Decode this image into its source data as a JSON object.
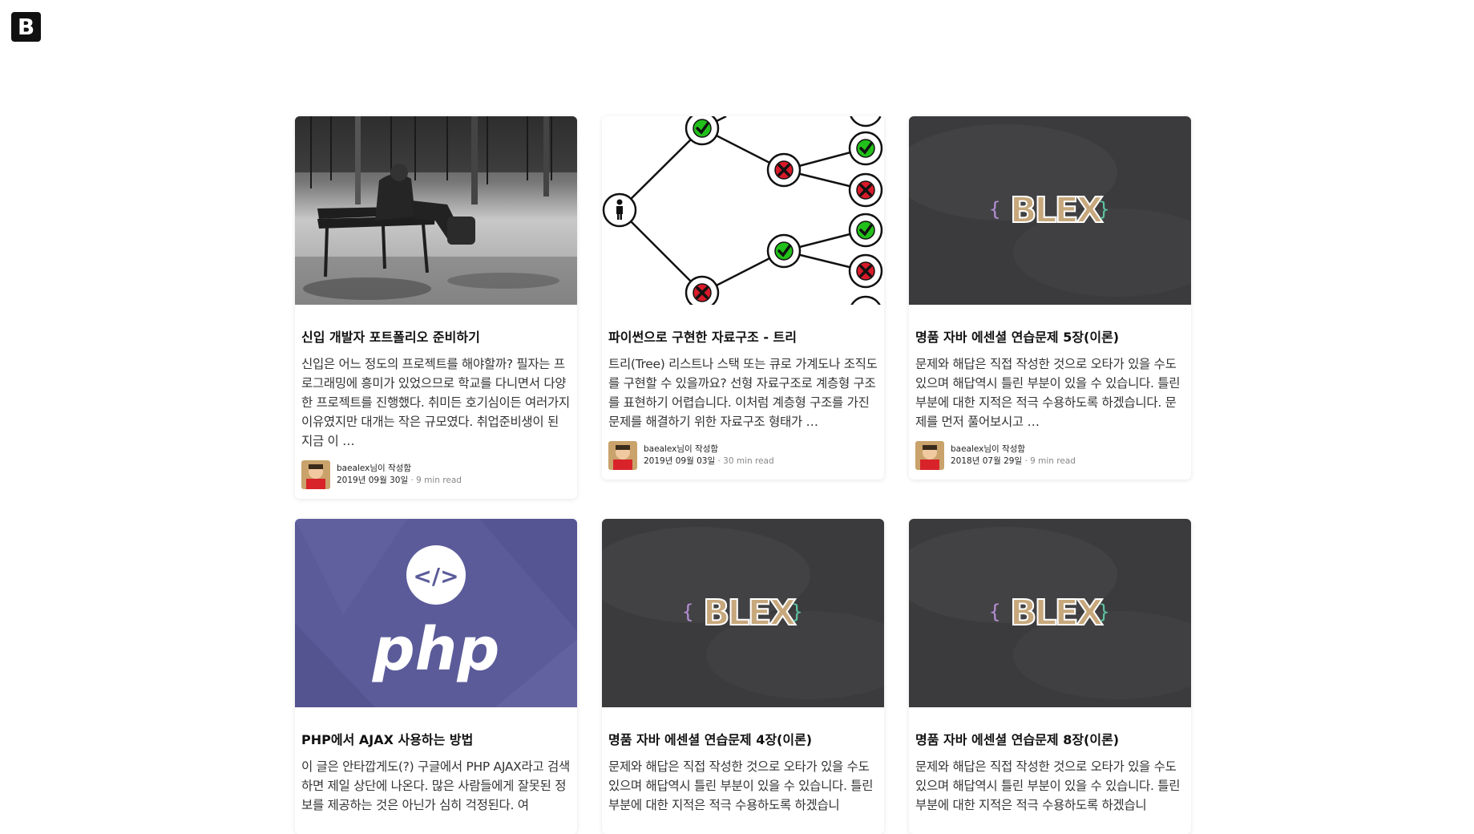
{
  "header": {
    "logo_letter": "B"
  },
  "posts": [
    {
      "title": "신입 개발자 포트폴리오 준비하기",
      "desc": "신입은 어느 정도의 프로젝트를 해야할까? 필자는 프로그래밍에 흥미가 있었으므로 학교를 다니면서 다양한 프로젝트를 진행했다. 취미든 호기심이든 여러가지 이유였지만 대개는 작은 규모였다. 취업준비생이 된 지금 이 …",
      "author": "baealex님이 작성함",
      "date": "2019년 09월 30일",
      "sep": "·",
      "read": "9 min read",
      "thumb": "bench-photo"
    },
    {
      "title": "파이썬으로 구현한 자료구조 - 트리",
      "desc": "트리(Tree) 리스트나 스택 또는 큐로 가계도나 조직도를 구현할 수 있을까요? 선형 자료구조로 계층형 구조를 표현하기 어렵습니다. 이처럼 계층형 구조를 가진 문제를 해결하기 위한 자료구조 형태가 …",
      "author": "baealex님이 작성함",
      "date": "2019년 09월 03일",
      "sep": "·",
      "read": "30 min read",
      "thumb": "tree-diagram"
    },
    {
      "title": "명품 자바 에센셜 연습문제 5장(이론)",
      "desc": "문제와 해답은 직접 작성한 것으로 오타가 있을 수도 있으며 해답역시 틀린 부분이 있을 수 있습니다. 틀린 부분에 대한 지적은 적극 수용하도록 하겠습니다. 문제를 먼저 풀어보시고 …",
      "author": "baealex님이 작성함",
      "date": "2018년 07월 29일",
      "sep": "·",
      "read": "9 min read",
      "thumb": "blex-chalkboard"
    },
    {
      "title": "PHP에서 AJAX 사용하는 방법",
      "desc": "이 글은 안타깝게도(?) 구글에서 PHP AJAX라고 검색하면 제일 상단에 나온다. 많은 사람들에게 잘못된 정보를 제공하는 것은 아닌가 심히 걱정된다. 여",
      "author": "",
      "date": "",
      "sep": "",
      "read": "",
      "thumb": "php-logo"
    },
    {
      "title": "명품 자바 에센셜 연습문제 4장(이론)",
      "desc": "문제와 해답은 직접 작성한 것으로 오타가 있을 수도 있으며 해답역시 틀린 부분이 있을 수 있습니다. 틀린 부분에 대한 지적은 적극 수용하도록 하겠습니",
      "author": "",
      "date": "",
      "sep": "",
      "read": "",
      "thumb": "blex-chalkboard"
    },
    {
      "title": "명품 자바 에센셜 연습문제 8장(이론)",
      "desc": "문제와 해답은 직접 작성한 것으로 오타가 있을 수도 있으며 해답역시 틀린 부분이 있을 수 있습니다. 틀린 부분에 대한 지적은 적극 수용하도록 하겠습니",
      "author": "",
      "date": "",
      "sep": "",
      "read": "",
      "thumb": "blex-chalkboard"
    }
  ],
  "thumb_text": {
    "blex_brace_open": "{",
    "blex_word": "BLEX",
    "blex_brace_close": "}",
    "php_word": "php",
    "php_code_icon": "</>"
  },
  "colors": {
    "chalkboard": "#3b3b3d",
    "php_bg": "#5b5b9a",
    "check_green": "#22c01a",
    "cross_red": "#d81b2a"
  }
}
